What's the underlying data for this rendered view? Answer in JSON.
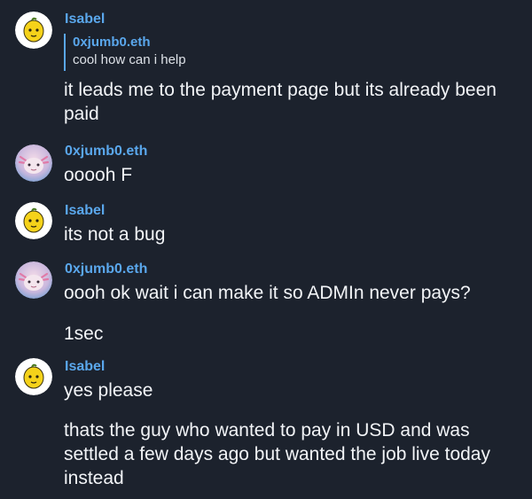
{
  "colors": {
    "background": "#1c222d",
    "sender_name": "#5aa7ec",
    "message_text": "#f2f4f7"
  },
  "messages": [
    {
      "sender": "Isabel",
      "avatar": "lemon-avatar-icon",
      "reply_to": {
        "sender": "0xjumb0.eth",
        "text": "cool how can i help"
      },
      "lines": [
        "it leads me to the payment page but its already been paid"
      ]
    },
    {
      "sender": "0xjumb0.eth",
      "avatar": "axolotl-avatar-icon",
      "lines": [
        "ooooh F"
      ]
    },
    {
      "sender": "Isabel",
      "avatar": "lemon-avatar-icon",
      "lines": [
        "its not a bug"
      ]
    },
    {
      "sender": "0xjumb0.eth",
      "avatar": "axolotl-avatar-icon",
      "lines": [
        "oooh ok wait i can make it so ADMIn never pays?",
        "1sec"
      ]
    },
    {
      "sender": "Isabel",
      "avatar": "lemon-avatar-icon",
      "lines": [
        "yes please",
        "thats the guy who wanted to pay in USD and was settled a few days ago but wanted the job live today instead"
      ]
    }
  ]
}
